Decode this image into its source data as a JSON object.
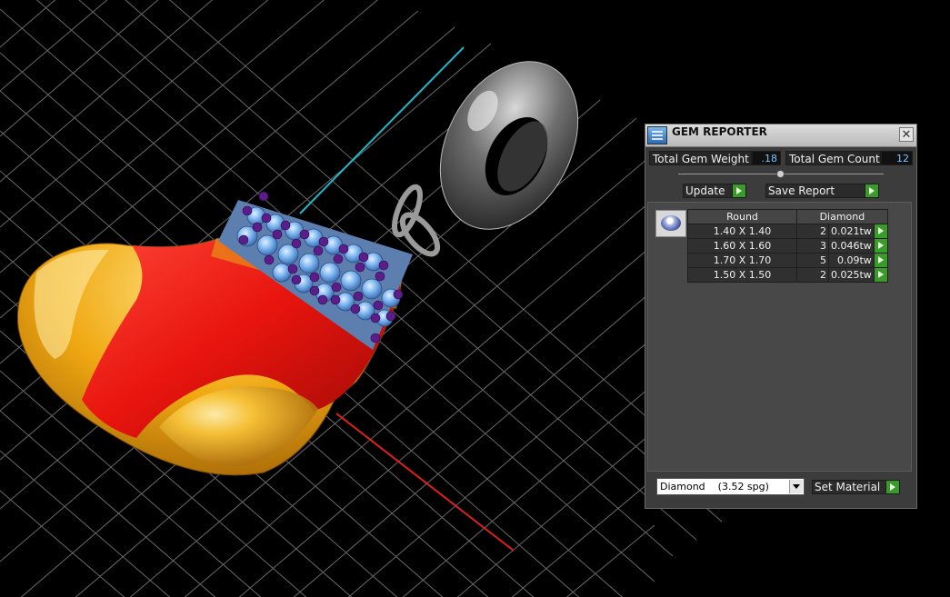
{
  "panel": {
    "title": "GEM REPORTER",
    "close_glyph": "✕",
    "total_weight_label": "Total Gem Weight",
    "total_weight_value": ".18",
    "total_count_label": "Total Gem Count",
    "total_count_value": "12",
    "update_label": "Update",
    "save_label": "Save Report",
    "table": {
      "headers": [
        "Round",
        "Diamond"
      ],
      "rows": [
        {
          "size": "1.40 X 1.40",
          "count": "2",
          "tw": "0.021tw"
        },
        {
          "size": "1.60 X 1.60",
          "count": "3",
          "tw": "0.046tw"
        },
        {
          "size": "1.70 X 1.70",
          "count": "5",
          "tw": "0.09tw"
        },
        {
          "size": "1.50 X 1.50",
          "count": "2",
          "tw": "0.025tw"
        }
      ]
    },
    "material_value": "Diamond    (3.52 spg)",
    "set_material_label": "Set Material"
  },
  "colors": {
    "grid": "#8c8c8c",
    "axis_x": "#e0201c",
    "axis_y": "#1fb8c8",
    "sock_red": "#e8140e",
    "sock_gold": "#f2b21e",
    "gem": "#7fb6f0",
    "prong": "#5a1d8a",
    "accent_green": "#3a9a2a"
  },
  "icons": [
    "gem-reporter-icon",
    "close-icon",
    "play-icon",
    "diamond-icon",
    "dropdown-arrow-icon"
  ]
}
